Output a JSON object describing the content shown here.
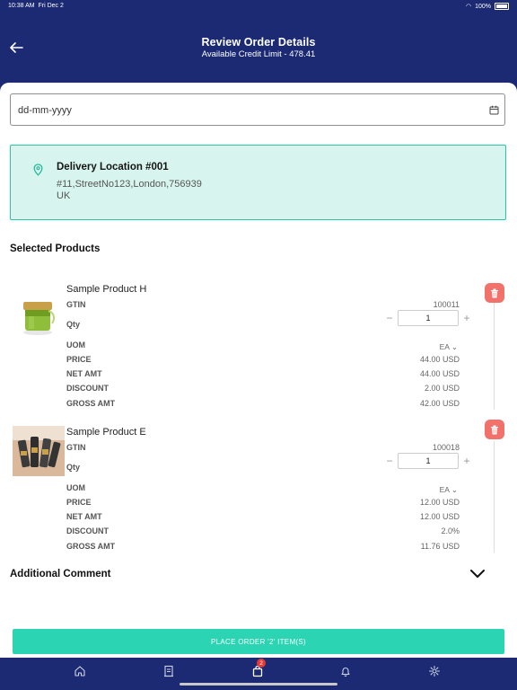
{
  "status": {
    "time": "10:38 AM",
    "date": "Fri Dec 2",
    "battery": "100%"
  },
  "header": {
    "title": "Review Order Details",
    "subtitle": "Available Credit Limit - 478.41"
  },
  "date_field": {
    "value": "dd-mm-yyyy"
  },
  "delivery": {
    "name": "Delivery Location #001",
    "address_line1": "#11,StreetNo123,London,756939",
    "address_line2": "UK"
  },
  "selected_products_title": "Selected Products",
  "products": [
    {
      "name": "Sample Product H",
      "gtin_label": "GTIN",
      "gtin": "100011",
      "qty_label": "Qty",
      "qty": "1",
      "uom_label": "UOM",
      "uom": "EA",
      "price_label": "PRICE",
      "price": "44.00 USD",
      "net_label": "NET AMT",
      "net": "44.00 USD",
      "discount_label": "DISCOUNT",
      "discount": "2.00 USD",
      "gross_label": "GROSS AMT",
      "gross": "42.00 USD"
    },
    {
      "name": "Sample Product E",
      "gtin_label": "GTIN",
      "gtin": "100018",
      "qty_label": "Qty",
      "qty": "1",
      "uom_label": "UOM",
      "uom": "EA",
      "price_label": "PRICE",
      "price": "12.00 USD",
      "net_label": "NET AMT",
      "net": "12.00 USD",
      "discount_label": "DISCOUNT",
      "discount": "2.0%",
      "gross_label": "GROSS AMT",
      "gross": "11.76 USD"
    }
  ],
  "additional_comment": "Additional Comment",
  "place_order": "PLACE ORDER  '2' ITEM(S)",
  "tabbar": {
    "items": [
      "home-icon",
      "receipt-icon",
      "cart-icon",
      "bell-icon",
      "gear-icon"
    ],
    "cart_badge": "2"
  },
  "colors": {
    "navy": "#1b2a73",
    "teal": "#2bd4b2",
    "delete": "#f2726b",
    "location_bg": "#d7f5ee"
  }
}
